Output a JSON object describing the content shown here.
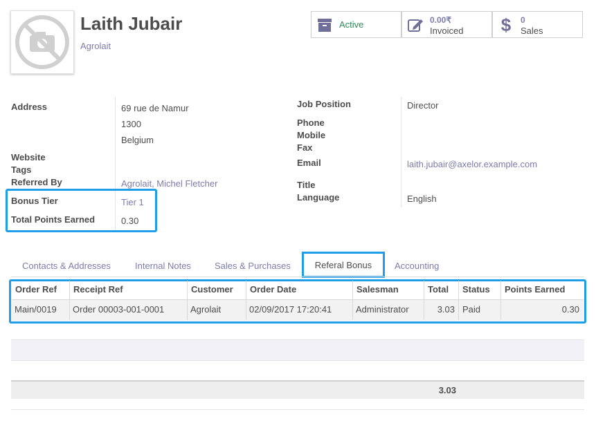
{
  "partner": {
    "name": "Laith Jubair",
    "company": "Agrolait",
    "avatar_icon": "camera-off-icon"
  },
  "stats": [
    {
      "value": "",
      "label": "Active",
      "icon": "archive-icon"
    },
    {
      "value": "0.00₹",
      "label": "Invoiced",
      "icon": "pencil-square-icon"
    },
    {
      "value": "0",
      "label": "Sales",
      "icon": "dollar-icon"
    }
  ],
  "left": {
    "address_label": "Address",
    "address_line1": "69 rue de Namur",
    "address_line2": "1300",
    "address_line3": "Belgium",
    "website_label": "Website",
    "tags_label": "Tags",
    "referred_label": "Referred By",
    "referred_value": "Agrolait, Michel Fletcher",
    "bonus_tier_label": "Bonus Tier",
    "bonus_tier_value": "Tier 1",
    "points_label": "Total Points Earned",
    "points_value": "0.30"
  },
  "right": {
    "job_label": "Job Position",
    "job_value": "Director",
    "phone_label": "Phone",
    "mobile_label": "Mobile",
    "fax_label": "Fax",
    "email_label": "Email",
    "email_value": "laith.jubair@axelor.example.com",
    "title_label": "Title",
    "language_label": "Language",
    "language_value": "English"
  },
  "tabs": [
    "Contacts & Addresses",
    "Internal Notes",
    "Sales & Purchases",
    "Referal Bonus",
    "Accounting"
  ],
  "table": {
    "headers": [
      "Order Ref",
      "Receipt Ref",
      "Customer",
      "Order Date",
      "Salesman",
      "Total",
      "Status",
      "Points Earned"
    ],
    "rows": [
      [
        "Main/0019",
        "Order 00003-001-0001",
        "Agrolait",
        "02/09/2017 17:20:41",
        "Administrator",
        "3.03",
        "Paid",
        "0.30"
      ]
    ],
    "footer_total": "3.03"
  },
  "colors": {
    "accent": "#7c7bad",
    "highlight": "#1e9ee6",
    "active": "#2e8b57"
  }
}
